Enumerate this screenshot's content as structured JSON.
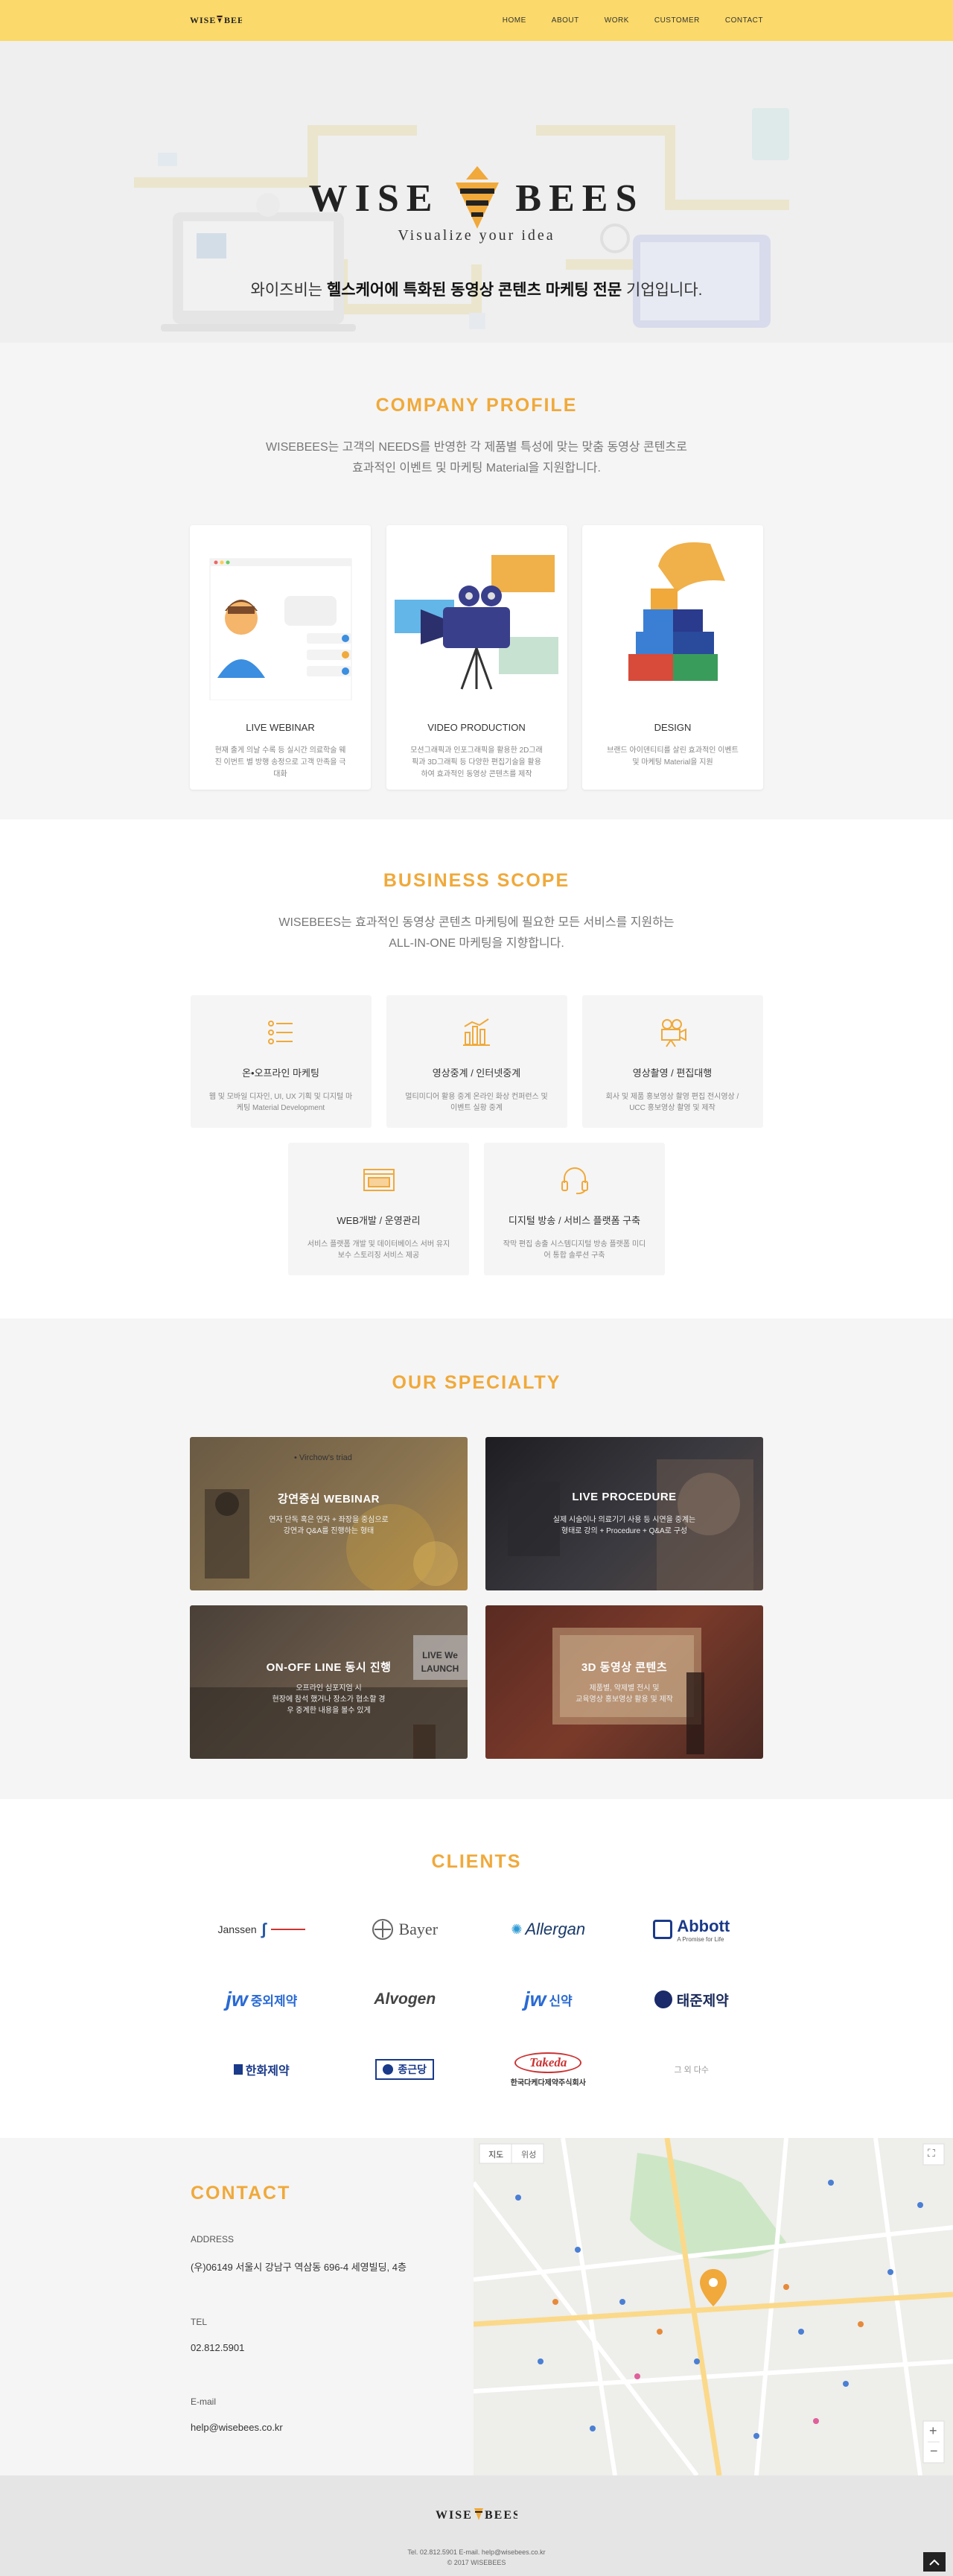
{
  "brand": {
    "name": "WISE BEES",
    "tagline": "Visualize your idea"
  },
  "nav": [
    {
      "label": "HOME"
    },
    {
      "label": "ABOUT"
    },
    {
      "label": "WORK"
    },
    {
      "label": "CUSTOMER"
    },
    {
      "label": "CONTACT"
    }
  ],
  "hero": {
    "copy_prefix": "와이즈비는 ",
    "copy_bold": "헬스케어에 특화된 동영상 콘텐츠 마케팅 전문",
    "copy_suffix": " 기업입니다."
  },
  "profile": {
    "title": "COMPANY PROFILE",
    "desc_line1": "WISEBEES는 고객의 NEEDS를 반영한 각 제품별 특성에 맞는 맞춤 동영상 콘텐츠로",
    "desc_line2": "효과적인 이벤트 및 마케팅 Material을 지원합니다.",
    "cards": [
      {
        "title": "LIVE WEBINAR",
        "desc": "현재 출게 의날 수록 등 실시간 의료학술 웨진 이번트 별 방행 송정으로 고객 만족을 극대화"
      },
      {
        "title": "VIDEO PRODUCTION",
        "desc": "모션그래픽과 인포그래픽을 활용한 2D그래픽과 3D그래픽 등 다양한 편집기술을 활용하여 효과적인 동영상 콘텐츠를 제작"
      },
      {
        "title": "DESIGN",
        "desc": "브랜드 아이덴티티를 살린 효과적인 이벤트 및 마케팅 Material을 지원"
      }
    ]
  },
  "scope": {
    "title": "BUSINESS SCOPE",
    "desc_line1": "WISEBEES는 효과적인 동영상 콘텐츠 마케팅에 필요한 모든 서비스를 지원하는",
    "desc_line2": "ALL-IN-ONE 마케팅을 지향합니다.",
    "items": [
      {
        "title": "온•오프라인 마케팅",
        "desc": "웹 및 모바일 디자인, UI, UX 기획 및 디지털 마케팅 Material Development"
      },
      {
        "title": "영상중계 / 인터넷중계",
        "desc": "멀티미디어 활용 중계 온라인 화상 컨퍼런스 및 이벤트 실황 중계"
      },
      {
        "title": "영상촬영 / 편집대행",
        "desc": "회사 및 제품 홍보영상 촬영 편집 전시영상 / UCC 홍보영상 촬영 및 제작"
      },
      {
        "title": "WEB개발 / 운영관리",
        "desc": "서비스 플랫폼 개발 및 데이터베이스 서버 유지보수 스토리징 서비스 제공"
      },
      {
        "title": "디지털 방송 / 서비스 플랫폼 구축",
        "desc": "작막 편집 송출 시스템디지털 방송 플랫폼 미디어 통합 솔루션 구축"
      }
    ]
  },
  "specialty": {
    "title": "OUR SPECIALTY",
    "items": [
      {
        "title": "강연중심 WEBINAR",
        "desc_line1": "연자 단독 혹은 연자 + 좌장을 중심으로",
        "desc_line2": "강연과 Q&A를 진행하는 형태",
        "sign": "• Virchow's triad"
      },
      {
        "title": "LIVE PROCEDURE",
        "desc_line1": "실제 시술이나 의료기기 사용 등 시연을 중계는",
        "desc_line2": "형태로 강의 + Procedure + Q&A로 구성",
        "sign": ""
      },
      {
        "title": "ON-OFF LINE 동시 진행",
        "desc_line1": "오프라인 심포지엄 시",
        "desc_line2": "현장에 참석 했거나 장소가 협소할 경우 중계한 내용을 볼수 있게",
        "sign": "LIVE We LAUNCH"
      },
      {
        "title": "3D 동영상 콘텐츠",
        "desc_line1": "제품별, 약제별 전시 및",
        "desc_line2": "교육영상 홍보영상 활용 및 제작",
        "sign": ""
      }
    ]
  },
  "clients": {
    "title": "CLIENTS",
    "logos": [
      {
        "name": "Janssen"
      },
      {
        "name": "Bayer"
      },
      {
        "name": "Allergan"
      },
      {
        "name": "Abbott"
      },
      {
        "name": "중외제약"
      },
      {
        "name": "Alvogen"
      },
      {
        "name": "신약"
      },
      {
        "name": "태준제약"
      },
      {
        "name": "한화제약"
      },
      {
        "name": "종근당"
      },
      {
        "name": "Takeda"
      },
      {
        "name": "그 외 다수"
      }
    ],
    "abbott_sub": "A Promise for Life",
    "takeda_sub": "한국다케다제약주식회사"
  },
  "contact": {
    "title": "CONTACT",
    "address_label": "ADDRESS",
    "address": "(우)06149 서울시 강남구 역삼동 696-4 세영빌딩, 4층",
    "tel_label": "TEL",
    "tel": "02.812.5901",
    "email_label": "E-mail",
    "email": "help@wisebees.co.kr",
    "map_tab1": "지도",
    "map_tab2": "위성"
  },
  "footer": {
    "line1": "Tel. 02.812.5901 E-mail. help@wisebees.co.kr",
    "line2": "© 2017 WISEBEES"
  },
  "colors": {
    "accent": "#f0a93a",
    "header": "#fbd96a"
  }
}
